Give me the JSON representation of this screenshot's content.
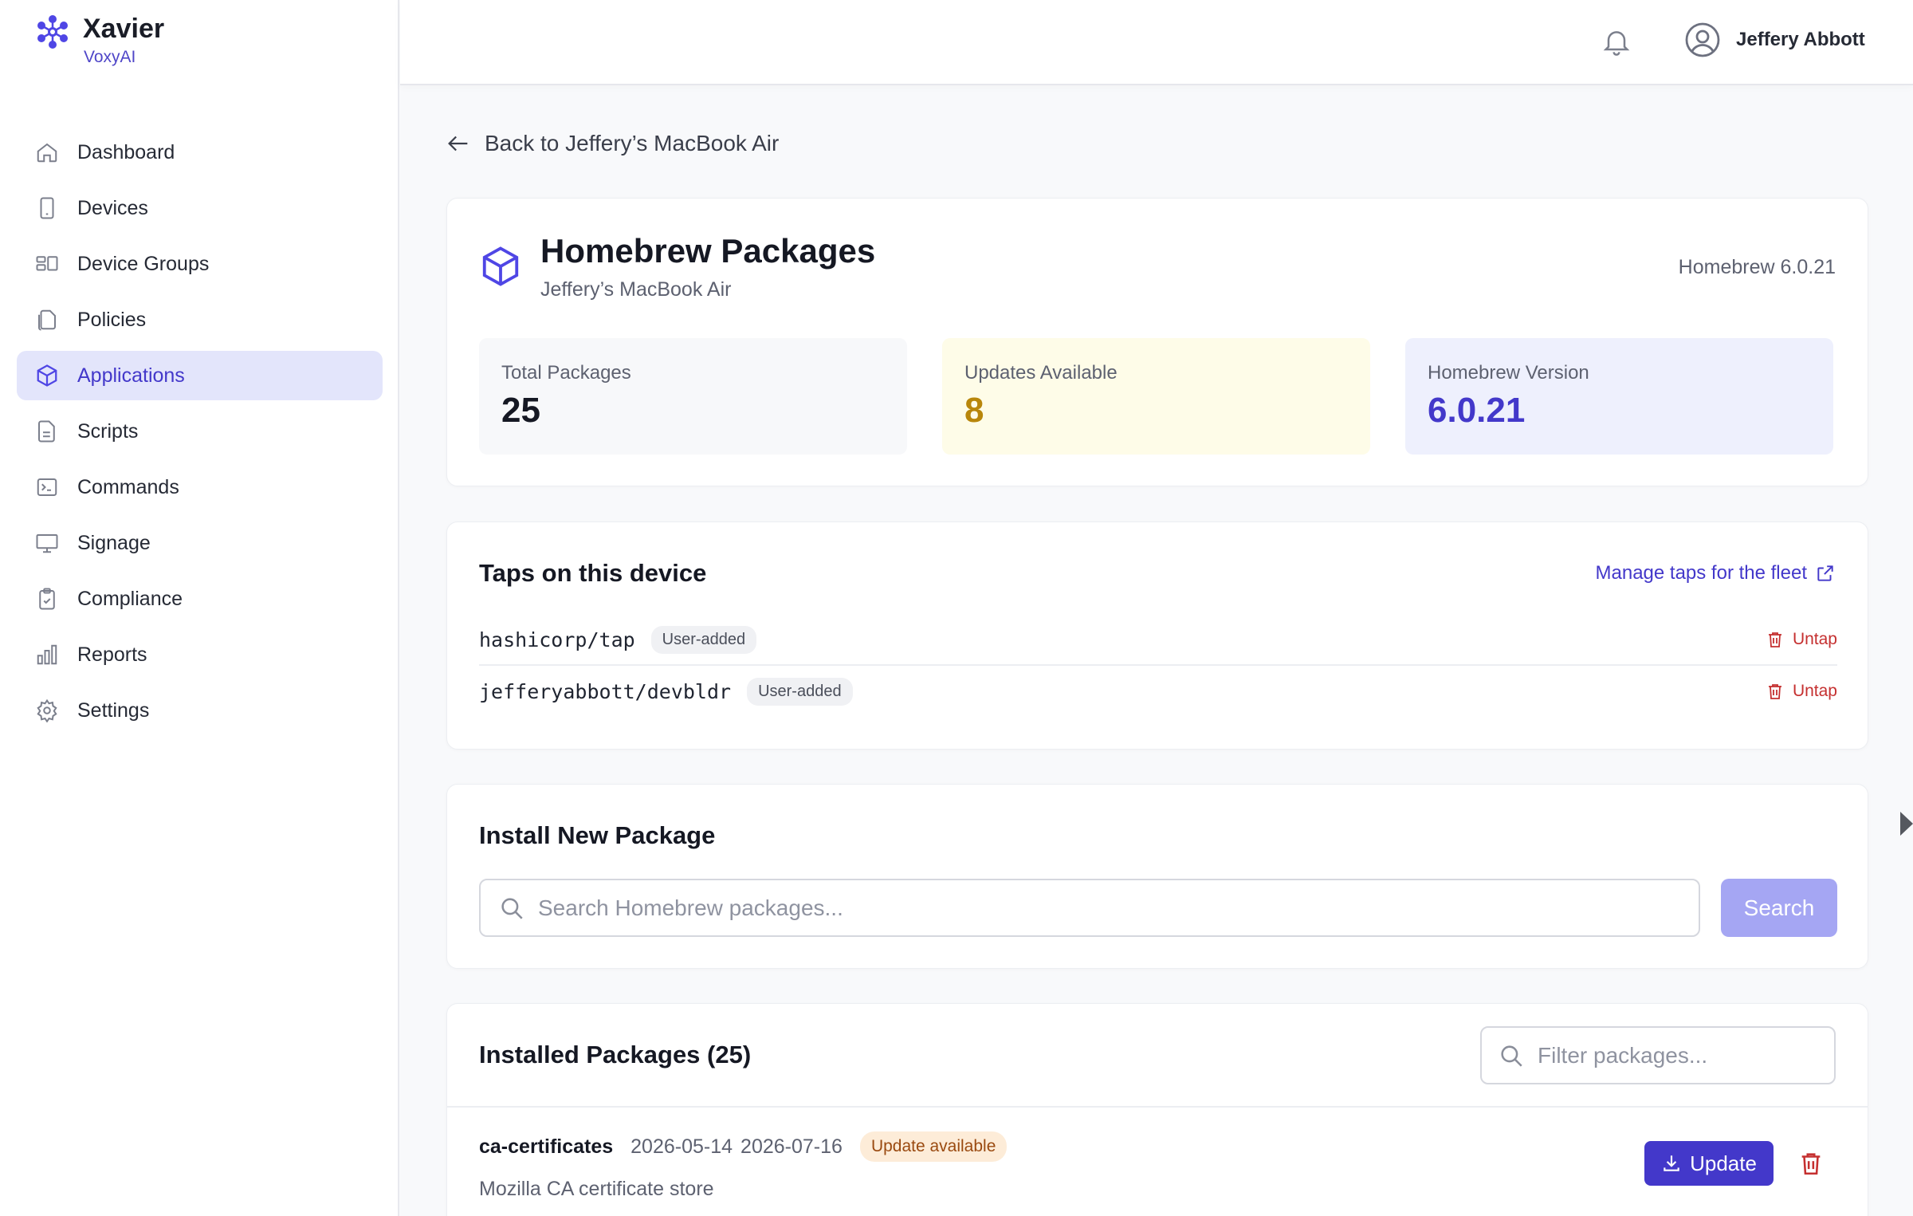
{
  "brand": {
    "name": "Xavier",
    "org": "VoxyAI"
  },
  "sidebar": {
    "items": [
      {
        "label": "Dashboard",
        "icon": "home-icon"
      },
      {
        "label": "Devices",
        "icon": "phone-icon"
      },
      {
        "label": "Device Groups",
        "icon": "device-groups-icon"
      },
      {
        "label": "Policies",
        "icon": "documents-icon"
      },
      {
        "label": "Applications",
        "icon": "cube-icon",
        "active": true
      },
      {
        "label": "Scripts",
        "icon": "file-icon"
      },
      {
        "label": "Commands",
        "icon": "terminal-icon"
      },
      {
        "label": "Signage",
        "icon": "monitor-icon"
      },
      {
        "label": "Compliance",
        "icon": "clipboard-check-icon"
      },
      {
        "label": "Reports",
        "icon": "bar-chart-icon"
      },
      {
        "label": "Settings",
        "icon": "gear-icon"
      }
    ]
  },
  "topbar": {
    "user_name": "Jeffery Abbott"
  },
  "back_link": "Back to Jeffery’s MacBook Air",
  "header": {
    "title": "Homebrew Packages",
    "subtitle": "Jeffery’s MacBook Air",
    "version_label": "Homebrew 6.0.21"
  },
  "stats": [
    {
      "label": "Total Packages",
      "value": "25"
    },
    {
      "label": "Updates Available",
      "value": "8"
    },
    {
      "label": "Homebrew Version",
      "value": "6.0.21"
    }
  ],
  "taps": {
    "title": "Taps on this device",
    "manage_link": "Manage taps for the fleet",
    "items": [
      {
        "name": "hashicorp/tap",
        "badge": "User-added",
        "action": "Untap"
      },
      {
        "name": "jefferyabbott/devbldr",
        "badge": "User-added",
        "action": "Untap"
      }
    ]
  },
  "install": {
    "title": "Install New Package",
    "placeholder": "Search Homebrew packages...",
    "button": "Search"
  },
  "installed": {
    "title": "Installed Packages (25)",
    "filter_placeholder": "Filter packages...",
    "packages": [
      {
        "name": "ca-certificates",
        "version": "2026-05-14",
        "latest": "2026-07-16",
        "badge": "Update available",
        "description": "Mozilla CA certificate store",
        "update_label": "Update"
      }
    ]
  },
  "colors": {
    "accent": "#4338ca",
    "active_bg": "#e3e5fb",
    "warning": "#b8860b",
    "danger": "#c53030"
  }
}
